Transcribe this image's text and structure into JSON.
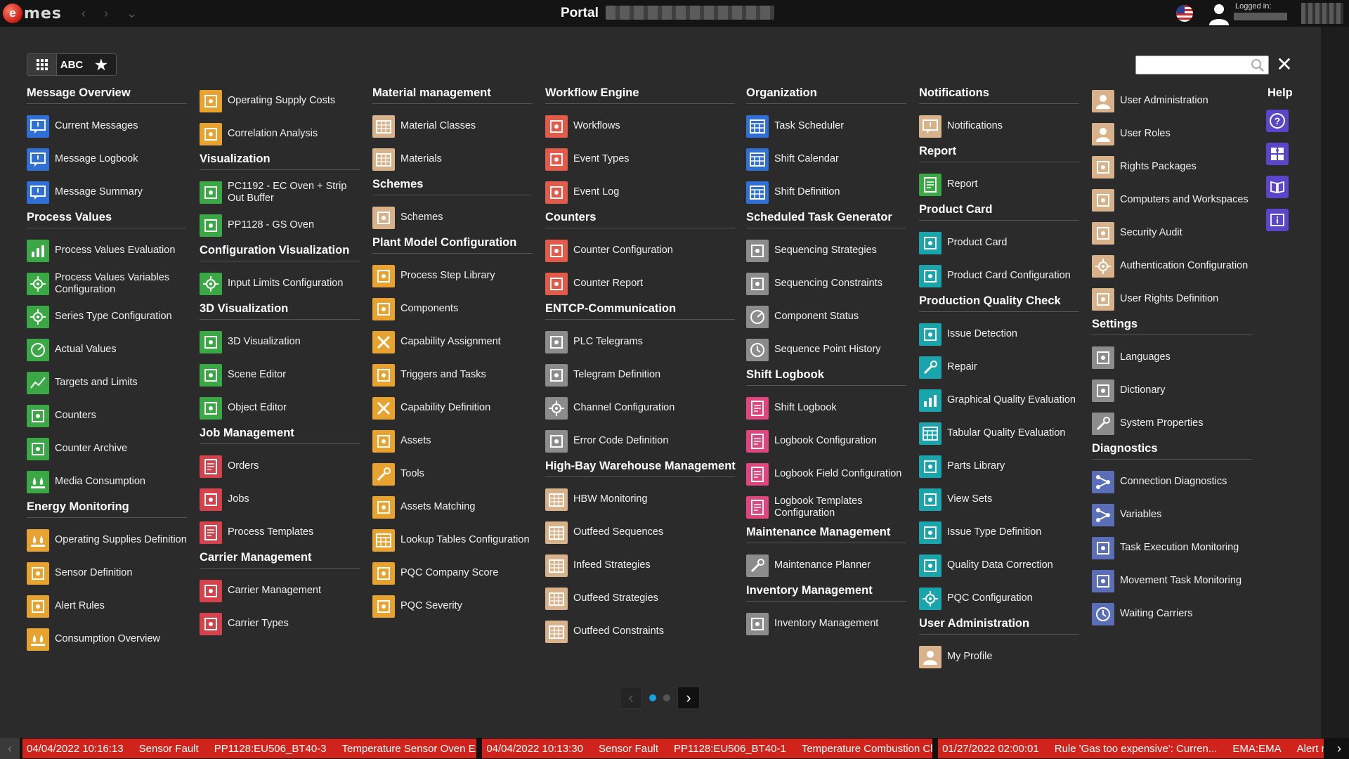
{
  "app": {
    "logo_letter": "e",
    "logo_text": "mes",
    "title": "Portal",
    "logged_in_label": "Logged in:"
  },
  "toolbar": {
    "view_tiles_icon": "grid-icon",
    "abc_label": "ABC",
    "favorites_icon": "star-icon",
    "search_placeholder": "",
    "close_icon": "close-icon"
  },
  "colors": {
    "accent_orange": "#e8a230",
    "accent_green": "#3aa845",
    "accent_blue": "#2f6fd6",
    "accent_red": "#d5424b",
    "accent_teal": "#1aa5ad",
    "accent_tan": "#d8b28a",
    "accent_purple": "#5b45c8",
    "alarm_red": "#d0231c",
    "pager_active": "#18a3e0"
  },
  "columns": [
    {
      "sections": [
        {
          "title": "Message Overview",
          "items": [
            {
              "label": "Current Messages",
              "color": "#2f6fd6",
              "icon": "message-icon"
            },
            {
              "label": "Message Logbook",
              "color": "#2f6fd6",
              "icon": "message-icon"
            },
            {
              "label": "Message Summary",
              "color": "#2f6fd6",
              "icon": "message-icon"
            }
          ]
        },
        {
          "title": "Process Values",
          "items": [
            {
              "label": "Process Values Evaluation",
              "color": "#3aa845",
              "icon": "bar-chart-icon"
            },
            {
              "label": "Process Values Variables Configuration",
              "color": "#3aa845",
              "icon": "gear-icon"
            },
            {
              "label": "Series Type Configuration",
              "color": "#3aa845",
              "icon": "gear-icon"
            },
            {
              "label": "Actual Values",
              "color": "#3aa845",
              "icon": "gauge-icon"
            },
            {
              "label": "Targets and Limits",
              "color": "#3aa845",
              "icon": "line-chart-icon"
            },
            {
              "label": "Counters",
              "color": "#3aa845",
              "icon": "counter-icon"
            },
            {
              "label": "Counter Archive",
              "color": "#3aa845",
              "icon": "counter-icon"
            },
            {
              "label": "Media Consumption",
              "color": "#3aa845",
              "icon": "drops-icon"
            }
          ]
        },
        {
          "title": "Energy Monitoring",
          "items": [
            {
              "label": "Operating Supplies Definition",
              "color": "#e8a230",
              "icon": "drops-icon"
            },
            {
              "label": "Sensor Definition",
              "color": "#e8a230",
              "icon": "sensor-icon"
            },
            {
              "label": "Alert Rules",
              "color": "#e8a230",
              "icon": "alert-icon"
            },
            {
              "label": "Consumption Overview",
              "color": "#e8a230",
              "icon": "drops-icon"
            }
          ]
        }
      ]
    },
    {
      "sections": [
        {
          "title": "",
          "items": [
            {
              "label": "Operating Supply Costs",
              "color": "#e8a230",
              "icon": "coins-icon"
            },
            {
              "label": "Correlation Analysis",
              "color": "#e8a230",
              "icon": "scatter-icon"
            }
          ]
        },
        {
          "title": "Visualization",
          "items": [
            {
              "label": "PC1192 - EC Oven + Strip Out Buffer",
              "color": "#3aa845",
              "icon": "image-icon"
            },
            {
              "label": "PP1128 - GS Oven",
              "color": "#3aa845",
              "icon": "image-icon"
            }
          ]
        },
        {
          "title": "Configuration Visualization",
          "items": [
            {
              "label": "Input Limits Configuration",
              "color": "#3aa845",
              "icon": "gear-icon"
            }
          ]
        },
        {
          "title": "3D Visualization",
          "items": [
            {
              "label": "3D Visualization",
              "color": "#3aa845",
              "icon": "image-icon"
            },
            {
              "label": "Scene Editor",
              "color": "#3aa845",
              "icon": "edit-icon"
            },
            {
              "label": "Object Editor",
              "color": "#3aa845",
              "icon": "cube-icon"
            }
          ]
        },
        {
          "title": "Job Management",
          "items": [
            {
              "label": "Orders",
              "color": "#d5424b",
              "icon": "document-icon"
            },
            {
              "label": "Jobs",
              "color": "#d5424b",
              "icon": "briefcase-icon"
            },
            {
              "label": "Process Templates",
              "color": "#d5424b",
              "icon": "template-icon"
            }
          ]
        },
        {
          "title": "Carrier Management",
          "items": [
            {
              "label": "Carrier Management",
              "color": "#d5424b",
              "icon": "carrier-icon"
            },
            {
              "label": "Carrier Types",
              "color": "#d5424b",
              "icon": "carrier-icon"
            }
          ]
        }
      ]
    },
    {
      "sections": [
        {
          "title": "Material management",
          "items": [
            {
              "label": "Material Classes",
              "color": "#d8b28a",
              "icon": "boxes-icon"
            },
            {
              "label": "Materials",
              "color": "#d8b28a",
              "icon": "boxes-icon"
            }
          ]
        },
        {
          "title": "Schemes",
          "items": [
            {
              "label": "Schemes",
              "color": "#d8b28a",
              "icon": "scheme-icon"
            }
          ]
        },
        {
          "title": "Plant Model Configuration",
          "items": [
            {
              "label": "Process Step Library",
              "color": "#e8a230",
              "icon": "library-icon"
            },
            {
              "label": "Components",
              "color": "#e8a230",
              "icon": "component-icon"
            },
            {
              "label": "Capability Assignment",
              "color": "#e8a230",
              "icon": "cross-icon"
            },
            {
              "label": "Triggers and Tasks",
              "color": "#e8a230",
              "icon": "trigger-icon"
            },
            {
              "label": "Capability Definition",
              "color": "#e8a230",
              "icon": "cross-icon"
            },
            {
              "label": "Assets",
              "color": "#e8a230",
              "icon": "asset-icon"
            },
            {
              "label": "Tools",
              "color": "#e8a230",
              "icon": "tools-icon"
            },
            {
              "label": "Assets Matching",
              "color": "#e8a230",
              "icon": "asset-icon"
            },
            {
              "label": "Lookup Tables Configuration",
              "color": "#e8a230",
              "icon": "table-icon"
            },
            {
              "label": "PQC Company Score",
              "color": "#e8a230",
              "icon": "score-icon"
            },
            {
              "label": "PQC Severity",
              "color": "#e8a230",
              "icon": "score-icon"
            }
          ]
        }
      ]
    },
    {
      "sections": [
        {
          "title": "Workflow Engine",
          "items": [
            {
              "label": "Workflows",
              "color": "#e15a4a",
              "icon": "workflow-icon"
            },
            {
              "label": "Event Types",
              "color": "#e15a4a",
              "icon": "event-icon"
            },
            {
              "label": "Event Log",
              "color": "#e15a4a",
              "icon": "event-icon"
            }
          ]
        },
        {
          "title": "Counters",
          "items": [
            {
              "label": "Counter Configuration",
              "color": "#e15a4a",
              "icon": "counter-icon"
            },
            {
              "label": "Counter Report",
              "color": "#e15a4a",
              "icon": "counter-icon"
            }
          ]
        },
        {
          "title": "ENTCP-Communication",
          "items": [
            {
              "label": "PLC Telegrams",
              "color": "#8c8c8c",
              "icon": "telegram-icon"
            },
            {
              "label": "Telegram Definition",
              "color": "#8c8c8c",
              "icon": "telegram-icon"
            },
            {
              "label": "Channel Configuration",
              "color": "#8c8c8c",
              "icon": "gear-icon"
            },
            {
              "label": "Error Code Definition",
              "color": "#8c8c8c",
              "icon": "error-icon"
            }
          ]
        },
        {
          "title": "High-Bay Warehouse Management",
          "items": [
            {
              "label": "HBW Monitoring",
              "color": "#d8b28a",
              "icon": "warehouse-icon"
            },
            {
              "label": "Outfeed Sequences",
              "color": "#d8b28a",
              "icon": "warehouse-icon"
            },
            {
              "label": "Infeed Strategies",
              "color": "#d8b28a",
              "icon": "warehouse-icon"
            },
            {
              "label": "Outfeed Strategies",
              "color": "#d8b28a",
              "icon": "warehouse-icon"
            },
            {
              "label": "Outfeed Constraints",
              "color": "#d8b28a",
              "icon": "warehouse-icon"
            }
          ]
        }
      ]
    },
    {
      "sections": [
        {
          "title": "Organization",
          "items": [
            {
              "label": "Task Scheduler",
              "color": "#2f6fd6",
              "icon": "calendar-icon"
            },
            {
              "label": "Shift Calendar",
              "color": "#2f6fd6",
              "icon": "calendar-icon"
            },
            {
              "label": "Shift Definition",
              "color": "#2f6fd6",
              "icon": "calendar-icon"
            }
          ]
        },
        {
          "title": "Scheduled Task Generator",
          "items": [
            {
              "label": "Sequencing Strategies",
              "color": "#8c8c8c",
              "icon": "sequence-icon"
            },
            {
              "label": "Sequencing Constraints",
              "color": "#8c8c8c",
              "icon": "sequence-icon"
            },
            {
              "label": "Component Status",
              "color": "#8c8c8c",
              "icon": "status-icon"
            },
            {
              "label": "Sequence Point History",
              "color": "#8c8c8c",
              "icon": "history-icon"
            }
          ]
        },
        {
          "title": "Shift Logbook",
          "items": [
            {
              "label": "Shift Logbook",
              "color": "#e0457e",
              "icon": "logbook-icon"
            },
            {
              "label": "Logbook Configuration",
              "color": "#e0457e",
              "icon": "logbook-icon"
            },
            {
              "label": "Logbook Field Configuration",
              "color": "#e0457e",
              "icon": "logbook-icon"
            },
            {
              "label": "Logbook Templates Configuration",
              "color": "#e0457e",
              "icon": "logbook-icon"
            }
          ]
        },
        {
          "title": "Maintenance Management",
          "items": [
            {
              "label": "Maintenance Planner",
              "color": "#8c8c8c",
              "icon": "wrench-icon"
            }
          ]
        },
        {
          "title": "Inventory Management",
          "items": [
            {
              "label": "Inventory Management",
              "color": "#8c8c8c",
              "icon": "inventory-icon"
            }
          ]
        }
      ]
    },
    {
      "sections": [
        {
          "title": "Notifications",
          "items": [
            {
              "label": "Notifications",
              "color": "#d8b28a",
              "icon": "notification-icon"
            }
          ]
        },
        {
          "title": "Report",
          "items": [
            {
              "label": "Report",
              "color": "#3aa845",
              "icon": "report-icon"
            }
          ]
        },
        {
          "title": "Product Card",
          "items": [
            {
              "label": "Product Card",
              "color": "#1aa5ad",
              "icon": "card-icon"
            },
            {
              "label": "Product Card Configuration",
              "color": "#1aa5ad",
              "icon": "card-icon"
            }
          ]
        },
        {
          "title": "Production Quality Check",
          "items": [
            {
              "label": "Issue Detection",
              "color": "#1aa5ad",
              "icon": "issue-icon"
            },
            {
              "label": "Repair",
              "color": "#1aa5ad",
              "icon": "wrench-icon"
            },
            {
              "label": "Graphical Quality Evaluation",
              "color": "#1aa5ad",
              "icon": "chart-icon"
            },
            {
              "label": "Tabular Quality Evaluation",
              "color": "#1aa5ad",
              "icon": "table-icon"
            },
            {
              "label": "Parts Library",
              "color": "#1aa5ad",
              "icon": "library-icon"
            },
            {
              "label": "View Sets",
              "color": "#1aa5ad",
              "icon": "view-icon"
            },
            {
              "label": "Issue Type Definition",
              "color": "#1aa5ad",
              "icon": "issue-icon"
            },
            {
              "label": "Quality Data Correction",
              "color": "#1aa5ad",
              "icon": "edit-icon"
            },
            {
              "label": "PQC Configuration",
              "color": "#1aa5ad",
              "icon": "gear-icon"
            }
          ]
        },
        {
          "title": "User Administration",
          "items": [
            {
              "label": "My Profile",
              "color": "#d8b28a",
              "icon": "user-icon"
            }
          ]
        }
      ]
    },
    {
      "sections": [
        {
          "title": "",
          "items": [
            {
              "label": "User Administration",
              "color": "#d8b28a",
              "icon": "users-icon"
            },
            {
              "label": "User Roles",
              "color": "#d8b28a",
              "icon": "users-icon"
            },
            {
              "label": "Rights Packages",
              "color": "#d8b28a",
              "icon": "rights-icon"
            },
            {
              "label": "Computers and Workspaces",
              "color": "#d8b28a",
              "icon": "computer-icon"
            },
            {
              "label": "Security Audit",
              "color": "#d8b28a",
              "icon": "audit-icon"
            },
            {
              "label": "Authentication Configuration",
              "color": "#d8b28a",
              "icon": "gear-icon"
            },
            {
              "label": "User Rights Definition",
              "color": "#d8b28a",
              "icon": "rights-icon"
            }
          ]
        },
        {
          "title": "Settings",
          "items": [
            {
              "label": "Languages",
              "color": "#8c8c8c",
              "icon": "language-icon"
            },
            {
              "label": "Dictionary",
              "color": "#8c8c8c",
              "icon": "dictionary-icon"
            },
            {
              "label": "System Properties",
              "color": "#8c8c8c",
              "icon": "tools-icon"
            }
          ]
        },
        {
          "title": "Diagnostics",
          "items": [
            {
              "label": "Connection Diagnostics",
              "color": "#5a6fb8",
              "icon": "network-icon"
            },
            {
              "label": "Variables",
              "color": "#5a6fb8",
              "icon": "network-icon"
            },
            {
              "label": "Task Execution Monitoring",
              "color": "#5a6fb8",
              "icon": "monitor-icon"
            },
            {
              "label": "Movement Task Monitoring",
              "color": "#5a6fb8",
              "icon": "monitor-icon"
            },
            {
              "label": "Waiting Carriers",
              "color": "#5a6fb8",
              "icon": "clock-icon"
            }
          ]
        }
      ]
    }
  ],
  "help": {
    "title": "Help",
    "icons": [
      "question-icon",
      "puzzle-icon",
      "book-icon",
      "info-icon"
    ]
  },
  "pager": {
    "prev_icon": "chevron-left-icon",
    "next_icon": "chevron-right-icon",
    "pages": 2,
    "current": 1
  },
  "alarms": [
    {
      "time": "04/04/2022 10:16:13",
      "type": "Sensor Fault",
      "source": "PP1128:EU506_BT40-3",
      "text": "Temperature Sensor Oven Exh..."
    },
    {
      "time": "04/04/2022 10:13:30",
      "type": "Sensor Fault",
      "source": "PP1128:EU506_BT40-1",
      "text": "Temperature Combustion Cha..."
    },
    {
      "time": "01/27/2022 02:00:01",
      "type": "Rule 'Gas too expensive': Curren...",
      "source": "EMA:EMA",
      "text": "Alert rule"
    }
  ]
}
